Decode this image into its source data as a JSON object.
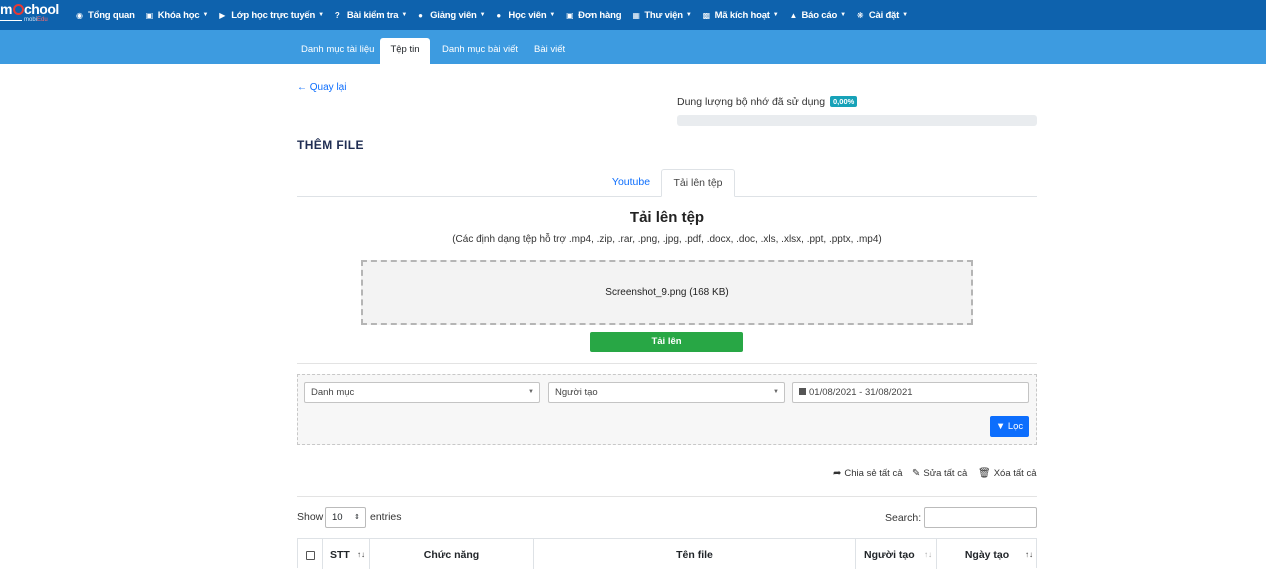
{
  "logo": {
    "brand": "mSchool",
    "brand_prefix": "m",
    "brand_suffix": "chool",
    "sub_prefix": "mobi",
    "sub_suffix": "Edu"
  },
  "topnav": [
    {
      "label": "Tổng quan",
      "icon": "dashboard-icon",
      "caret": false
    },
    {
      "label": "Khóa học",
      "icon": "book-icon",
      "caret": true
    },
    {
      "label": "Lớp học trực tuyến",
      "icon": "video-icon",
      "caret": true
    },
    {
      "label": "Bài kiểm tra",
      "icon": "question-icon",
      "caret": true
    },
    {
      "label": "Giảng viên",
      "icon": "users-icon",
      "caret": true
    },
    {
      "label": "Học viên",
      "icon": "user-icon",
      "caret": true
    },
    {
      "label": "Đơn hàng",
      "icon": "cart-icon",
      "caret": false
    },
    {
      "label": "Thư viện",
      "icon": "library-icon",
      "caret": true
    },
    {
      "label": "Mã kích hoạt",
      "icon": "key-icon",
      "caret": true
    },
    {
      "label": "Báo cáo",
      "icon": "chart-icon",
      "caret": true
    },
    {
      "label": "Cài đặt",
      "icon": "gears-icon",
      "caret": true
    }
  ],
  "subnav": [
    {
      "label": "Danh mục tài liệu",
      "active": false
    },
    {
      "label": "Tệp tin",
      "active": true
    },
    {
      "label": "Danh mục bài viết",
      "active": false
    },
    {
      "label": "Bài viết",
      "active": false
    }
  ],
  "back_label": "Quay lại",
  "storage": {
    "label": "Dung lượng bộ nhớ đã sử dụng",
    "percent_text": "0,00%",
    "percent": 0
  },
  "page_title": "THÊM FILE",
  "tabs": [
    {
      "label": "Youtube",
      "active": false
    },
    {
      "label": "Tải lên tệp",
      "active": true
    }
  ],
  "upload": {
    "title": "Tải lên tệp",
    "formats": "(Các định dạng tệp hỗ trợ .mp4, .zip, .rar, .png, .jpg, .pdf, .docx, .doc, .xls, .xlsx, .ppt, .pptx, .mp4)",
    "file": "Screenshot_9.png (168 KB)",
    "button": "Tải lên"
  },
  "filters": {
    "category": "Danh mục",
    "creator": "Người tạo",
    "date_range": "01/08/2021 - 31/08/2021",
    "button": "Lọc"
  },
  "bulk_actions": {
    "share": "Chia sẻ tất cả",
    "edit": "Sửa tất cả",
    "delete": "Xóa tất cả"
  },
  "table_controls": {
    "show": "Show",
    "length": "10",
    "entries": "entries",
    "search": "Search:"
  },
  "columns": [
    "STT",
    "Chức năng",
    "Tên file",
    "Người tạo",
    "Ngày tạo"
  ],
  "colors": {
    "topnav": "#0e62ad",
    "subnav": "#3d9be0",
    "success": "#28a745",
    "primary": "#0d6efd",
    "info": "#17a2b8"
  }
}
